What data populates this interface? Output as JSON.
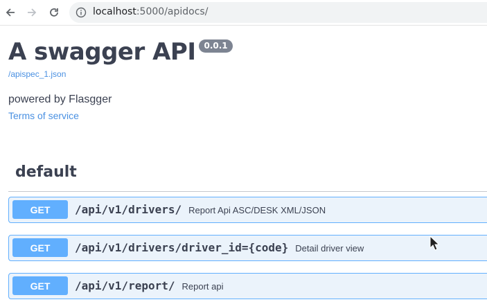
{
  "browser": {
    "back_icon": "arrow-left-icon",
    "forward_icon": "arrow-right-icon",
    "reload_icon": "reload-icon",
    "info_icon": "info-icon",
    "url_host": "localhost",
    "url_port_path": ":5000/apidocs/"
  },
  "info": {
    "title": "A swagger API",
    "version": "0.0.1",
    "spec_link": "/apispec_1.json",
    "description": "powered by Flasgger",
    "terms_link": "Terms of service"
  },
  "tags": [
    {
      "name": "default",
      "operations": [
        {
          "method": "GET",
          "path": "/api/v1/drivers/",
          "summary": "Report Api ASC/DESK XML/JSON"
        },
        {
          "method": "GET",
          "path": "/api/v1/drivers/driver_id={code}",
          "summary": "Detail driver view"
        },
        {
          "method": "GET",
          "path": "/api/v1/report/",
          "summary": "Report api"
        }
      ]
    }
  ],
  "colors": {
    "get_method": "#61affe",
    "get_background": "#ebf3fb",
    "link": "#4990e2",
    "text": "#3b4151",
    "version_badge": "#7d8492"
  }
}
